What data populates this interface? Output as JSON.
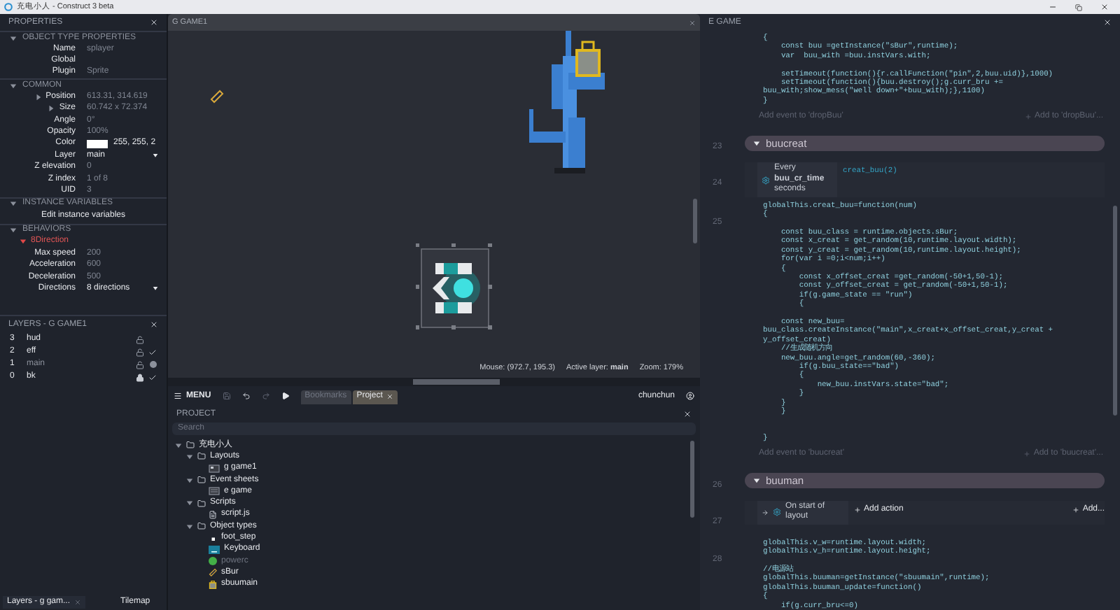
{
  "window": {
    "title": "充电小人 - Construct 3 beta"
  },
  "properties": {
    "title": "PROPERTIES",
    "sections": [
      {
        "title": "OBJECT TYPE PROPERTIES",
        "expanded": true,
        "rows": [
          {
            "kind": "text",
            "label": "Name",
            "value": "splayer"
          },
          {
            "kind": "text",
            "label": "Global"
          },
          {
            "kind": "text",
            "label": "Plugin",
            "value": "Sprite"
          }
        ]
      },
      {
        "title": "COMMON",
        "expanded": true,
        "rows": [
          {
            "kind": "expander",
            "label": "Position",
            "value": "613.31, 314.619"
          },
          {
            "kind": "expander",
            "label": "Size",
            "value": "60.742 x 72.374"
          },
          {
            "kind": "text",
            "label": "Angle",
            "value": "0°"
          },
          {
            "kind": "text",
            "label": "Opacity",
            "value": "100%"
          },
          {
            "kind": "color",
            "label": "Color",
            "value": "255, 255, 2",
            "color": "#ffffff"
          },
          {
            "kind": "dropdown",
            "label": "Layer",
            "value": "main"
          },
          {
            "kind": "text",
            "label": "Z elevation",
            "value": "0"
          },
          {
            "kind": "text",
            "label": "Z index",
            "value": "1 of 8"
          },
          {
            "kind": "text",
            "label": "UID",
            "value": "3"
          }
        ]
      },
      {
        "title": "INSTANCE VARIABLES",
        "expanded": true,
        "rows": [
          {
            "kind": "button",
            "label": "Edit instance variables"
          }
        ]
      },
      {
        "title": "BEHAVIORS",
        "expanded": true,
        "rows": [
          {
            "kind": "behavior",
            "label": "8Direction"
          },
          {
            "kind": "text",
            "label": "Max speed",
            "value": "200"
          },
          {
            "kind": "text",
            "label": "Acceleration",
            "value": "600"
          },
          {
            "kind": "text",
            "label": "Deceleration",
            "value": "500"
          },
          {
            "kind": "dropdown",
            "label": "Directions",
            "value": "8 directions"
          }
        ]
      }
    ]
  },
  "layers": {
    "title": "LAYERS - G GAME1",
    "items": [
      {
        "number": "3",
        "name": "hud",
        "locked": false,
        "visible": false,
        "selected": false
      },
      {
        "number": "2",
        "name": "eff",
        "locked": false,
        "visible": true,
        "selected": false
      },
      {
        "number": "1",
        "name": "main",
        "locked": false,
        "visible": false,
        "selected": true
      },
      {
        "number": "0",
        "name": "bk",
        "locked": true,
        "visible": true,
        "selected": false
      }
    ]
  },
  "bottom_tabs": [
    {
      "label": "Layers - g gam...",
      "selected": true
    },
    {
      "label": "Tilemap",
      "selected": false
    }
  ],
  "layout_view": {
    "title": "G GAME1",
    "status": [
      "Mouse: (972.7, 195.3)",
      "Active layer: **main**",
      "Zoom: 179%"
    ]
  },
  "toolbar": {
    "menu": "MENU",
    "tabs": [
      {
        "label": "Bookmarks",
        "selected": false
      },
      {
        "label": "Project",
        "selected": true
      }
    ],
    "user": "chunchun"
  },
  "project": {
    "title": "PROJECT",
    "search_placeholder": "Search",
    "tree": [
      {
        "label": "充电小人",
        "kind": "folder",
        "expanded": true,
        "children": [
          {
            "label": "Layouts",
            "kind": "folder",
            "expanded": true,
            "children": [
              {
                "label": "g game1",
                "kind": "layout"
              }
            ]
          },
          {
            "label": "Event sheets",
            "kind": "folder",
            "expanded": true,
            "children": [
              {
                "label": "e game",
                "kind": "sheet"
              }
            ]
          },
          {
            "label": "Scripts",
            "kind": "folder",
            "expanded": true,
            "children": [
              {
                "label": "script.js",
                "kind": "script"
              }
            ]
          },
          {
            "label": "Object types",
            "kind": "folder",
            "expanded": true,
            "children": [
              {
                "label": "foot_step",
                "kind": "dot",
                "dimmed": false
              },
              {
                "label": "Keyboard",
                "kind": "keyboard",
                "dimmed": false
              },
              {
                "label": "powerc",
                "kind": "circle",
                "dimmed": true
              },
              {
                "label": "sBur",
                "kind": "gadget",
                "dimmed": false
              },
              {
                "label": "sbuumain",
                "kind": "crate",
                "dimmed": false
              }
            ]
          }
        ]
      }
    ]
  },
  "event_sheet": {
    "title": "E GAME",
    "blocks": [
      {
        "kind": "script",
        "code": "{\n    const buu =getInstance(\"sBur\",runtime);\n    var  buu_with =buu.instVars.with;\n\n    setTimeout(function(){r.callFunction(\"pin\",2,buu.uid)},1000)\n    setTimeout(function(){buu.destroy();g.curr_bru +=\nbuu_with;show_mess(\"well down+\"+buu_with);},1100)\n}"
      },
      {
        "kind": "add",
        "label": "Add event to 'dropBuu'",
        "action": "Add to 'dropBuu'..."
      },
      {
        "kind": "group",
        "number": "23",
        "name": "buucreat",
        "expanded": true
      },
      {
        "kind": "event",
        "number": "24",
        "trigger": false,
        "condition": "Every **buu_cr_time** seconds",
        "actions": [
          "creat_buu(2)"
        ]
      },
      {
        "kind": "script",
        "number": "25",
        "code": "globalThis.creat_buu=function(num)\n{\n\n    const buu_class = runtime.objects.sBur;\n    const x_creat = get_random(10,runtime.layout.width);\n    const y_creat = get_random(10,runtime.layout.height);\n    for(var i =0;i<num;i++)\n    {\n        const x_offset_creat =get_random(-50+1,50-1);\n        const y_offset_creat = get_random(-50+1,50-1);\n        if(g.game_state == \"run\")\n        {\n\n    const new_buu=\nbuu_class.createInstance(\"main\",x_creat+x_offset_creat,y_creat +\ny_offset_creat)\n    //生成随机方向\n    new_buu.angle=get_random(60,-360);\n        if(g.buu_state==\"bad\")\n        {\n            new_buu.instVars.state=\"bad\";\n        }\n    }\n    }\n\n\n}"
      },
      {
        "kind": "add",
        "label": "Add event to 'buucreat'",
        "action": "Add to 'buucreat'..."
      },
      {
        "kind": "group",
        "number": "26",
        "name": "buuman",
        "expanded": true
      },
      {
        "kind": "event",
        "number": "27",
        "trigger": true,
        "condition": "On start of layout",
        "add_action": "Add action",
        "add_more": "Add..."
      },
      {
        "kind": "script",
        "number": "28",
        "code": "globalThis.v_w=runtime.layout.width;\nglobalThis.v_h=runtime.layout.height;\n\n//电源站\nglobalThis.buuman=getInstance(\"sbuumain\",runtime);\nglobalThis.buuman_update=function()\n{\n    if(g.curr_bru<=0)"
      }
    ]
  }
}
